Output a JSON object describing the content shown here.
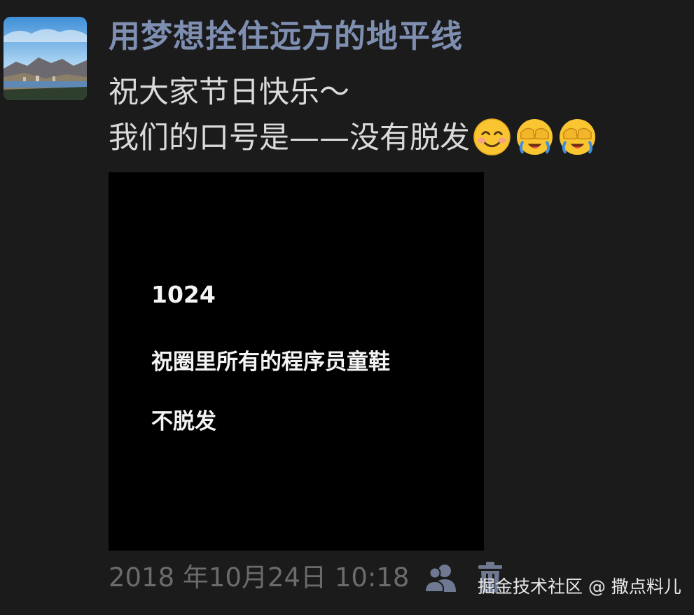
{
  "post": {
    "username": "用梦想拴住远方的地平线",
    "line1": "祝大家节日快乐～",
    "line2": "我们的口号是——没有脱发",
    "emojis": [
      "blush-smile-emoji",
      "facepalm-laugh-emoji",
      "facepalm-laugh-emoji"
    ],
    "image": {
      "line1": "1024",
      "line2": "祝圈里所有的程序员童鞋",
      "line3": "不脱发"
    },
    "timestamp": "2018 年10月24日 10:18",
    "icons": {
      "visibility": "friends-icon",
      "delete": "trash-icon"
    }
  },
  "watermark": "掘金技术社区 @ 撒点料儿",
  "colors": {
    "background": "#1b1b1b",
    "username": "#7f8fb2",
    "text": "#dadada",
    "timestamp": "#6b6b6b"
  }
}
